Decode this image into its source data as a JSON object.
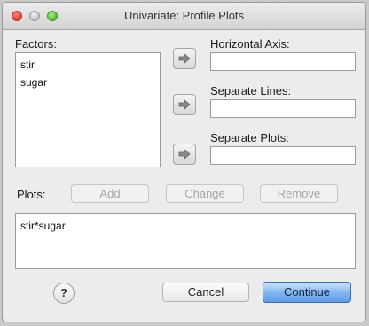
{
  "window": {
    "title": "Univariate: Profile Plots"
  },
  "factors": {
    "label": "Factors:",
    "items": [
      "stir",
      "sugar"
    ]
  },
  "fields": {
    "horizontal_axis": {
      "label": "Horizontal Axis:",
      "value": ""
    },
    "separate_lines": {
      "label": "Separate Lines:",
      "value": ""
    },
    "separate_plots": {
      "label": "Separate Plots:",
      "value": ""
    }
  },
  "plots": {
    "label": "Plots:",
    "add_label": "Add",
    "change_label": "Change",
    "remove_label": "Remove",
    "items": [
      "stir*sugar"
    ]
  },
  "footer": {
    "help_label": "?",
    "cancel_label": "Cancel",
    "continue_label": "Continue"
  },
  "colors": {
    "accent": "#5d9ce8",
    "window_bg": "#ececec"
  },
  "icons": {
    "move_arrow": "right-arrow-icon"
  }
}
